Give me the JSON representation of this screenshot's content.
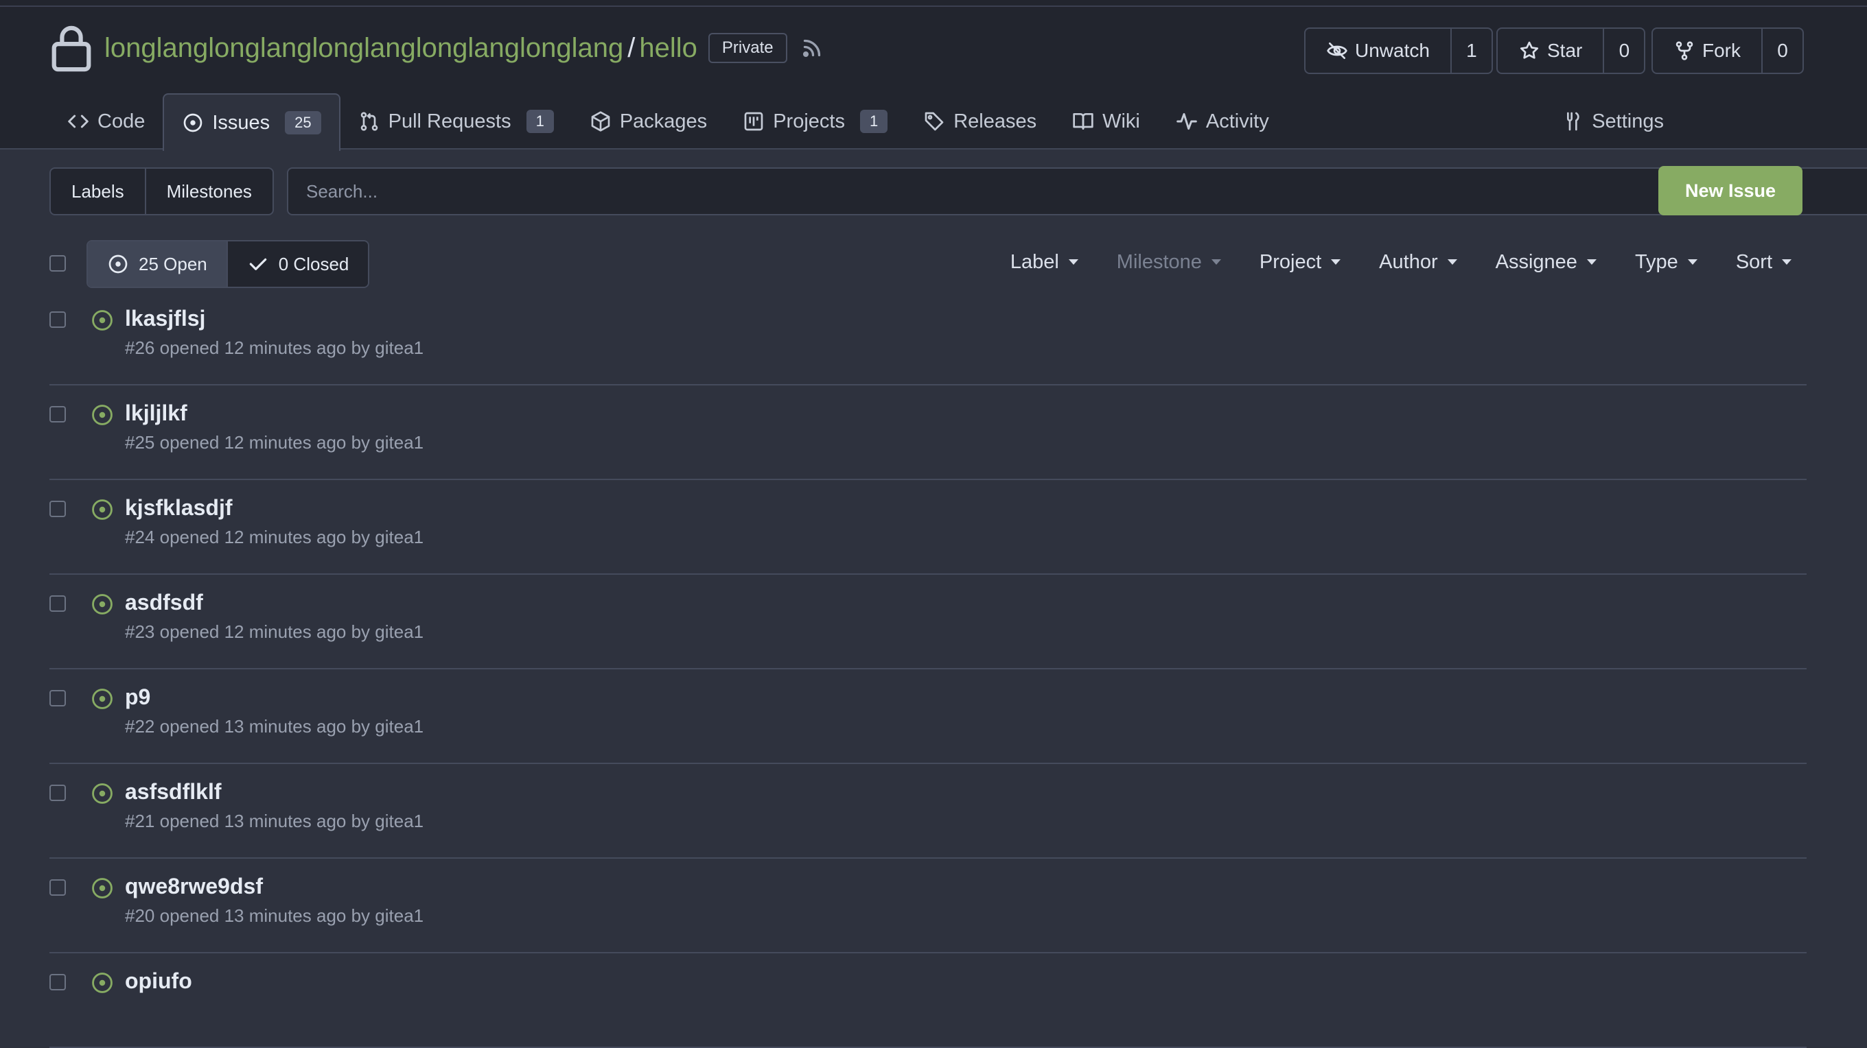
{
  "repo": {
    "owner": "longlanglonglanglonglanglonglanglonglang",
    "separator": "/",
    "name": "hello",
    "visibility": "Private"
  },
  "actions": {
    "watch": {
      "label": "Unwatch",
      "count": "1"
    },
    "star": {
      "label": "Star",
      "count": "0"
    },
    "fork": {
      "label": "Fork",
      "count": "0"
    }
  },
  "tabs": [
    {
      "label": "Code",
      "icon": "code-icon"
    },
    {
      "label": "Issues",
      "count": "25",
      "icon": "issue-open-icon"
    },
    {
      "label": "Pull Requests",
      "count": "1",
      "icon": "git-pull-request-icon"
    },
    {
      "label": "Packages",
      "icon": "package-icon"
    },
    {
      "label": "Projects",
      "count": "1",
      "icon": "project-icon"
    },
    {
      "label": "Releases",
      "icon": "tag-icon"
    },
    {
      "label": "Wiki",
      "icon": "book-icon"
    },
    {
      "label": "Activity",
      "icon": "pulse-icon"
    }
  ],
  "settings_label": "Settings",
  "toolbar": {
    "labels": "Labels",
    "milestones": "Milestones",
    "search_placeholder": "Search...",
    "new_issue": "New Issue"
  },
  "state": {
    "open": "25 Open",
    "closed": "0 Closed"
  },
  "filters": {
    "label": "Label",
    "milestone": "Milestone",
    "project": "Project",
    "author": "Author",
    "assignee": "Assignee",
    "type": "Type",
    "sort": "Sort"
  },
  "issues": [
    {
      "title": "lkasjflsj",
      "meta": "#26 opened 12 minutes ago by gitea1"
    },
    {
      "title": "lkjljlkf",
      "meta": "#25 opened 12 minutes ago by gitea1"
    },
    {
      "title": "kjsfklasdjf",
      "meta": "#24 opened 12 minutes ago by gitea1"
    },
    {
      "title": "asdfsdf",
      "meta": "#23 opened 12 minutes ago by gitea1"
    },
    {
      "title": "p9",
      "meta": "#22 opened 13 minutes ago by gitea1"
    },
    {
      "title": "asfsdflklf",
      "meta": "#21 opened 13 minutes ago by gitea1"
    },
    {
      "title": "qwe8rwe9dsf",
      "meta": "#20 opened 13 minutes ago by gitea1"
    },
    {
      "title": "opiufo",
      "meta": ""
    }
  ],
  "colors": {
    "accent": "#87ab63",
    "background": "#2e323e",
    "header_background": "#22252e"
  }
}
